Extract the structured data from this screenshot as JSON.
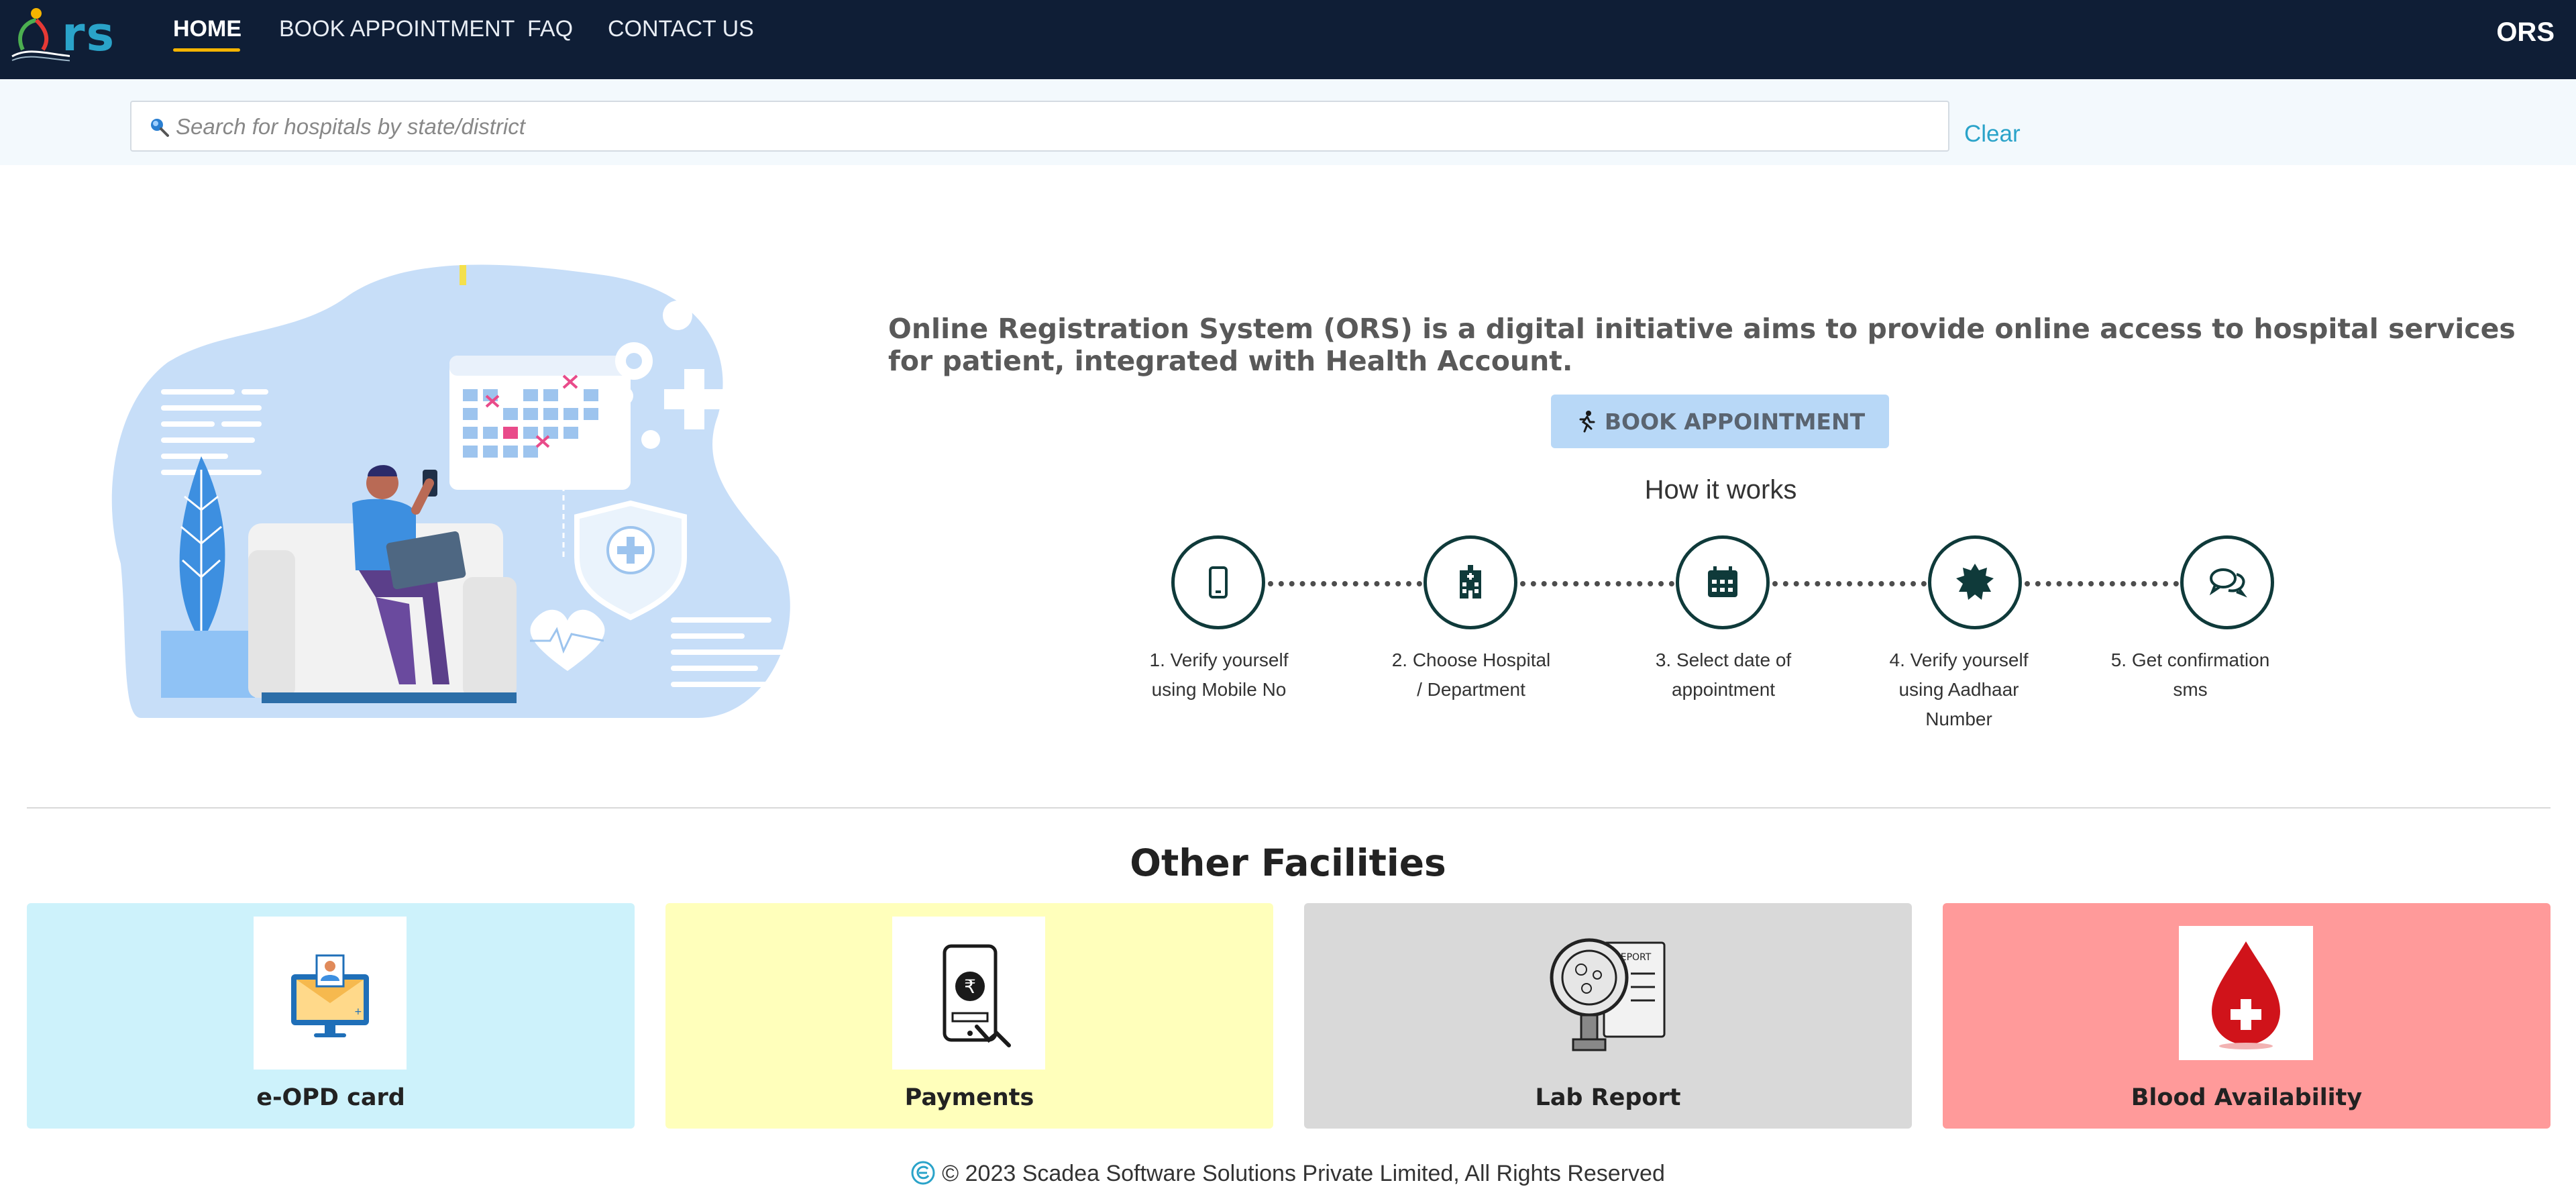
{
  "navbar": {
    "logo_text": "rs",
    "items": [
      {
        "label": "HOME"
      },
      {
        "label": "BOOK APPOINTMENT"
      },
      {
        "label": "FAQ"
      },
      {
        "label": "CONTACT US"
      }
    ],
    "right_label": "ORS"
  },
  "search": {
    "placeholder": "Search for hospitals by state/district",
    "value": "",
    "clear_label": "Clear"
  },
  "hero": {
    "description": "Online Registration System (ORS) is a digital initiative aims to provide online access to hospital services for patient, integrated with Health Account.",
    "book_button_label": "BOOK APPOINTMENT",
    "how_title": "How it works",
    "steps": [
      {
        "label": "1. Verify yourself using Mobile No",
        "icon": "mobile-icon"
      },
      {
        "label": "2. Choose Hospital / Department",
        "icon": "hospital-icon"
      },
      {
        "label": "3. Select date of appointment",
        "icon": "calendar-icon"
      },
      {
        "label": "4. Verify yourself using Aadhaar Number",
        "icon": "aadhaar-badge-icon"
      },
      {
        "label": "5. Get confirmation sms",
        "icon": "chat-icon"
      }
    ]
  },
  "facilities": {
    "title": "Other Facilities",
    "cards": [
      {
        "label": "e-OPD card",
        "color": "#cdf2fb",
        "icon": "eopd-card-icon"
      },
      {
        "label": "Payments",
        "color": "#ffffbb",
        "icon": "payments-icon"
      },
      {
        "label": "Lab Report",
        "color": "#d9d9d9",
        "icon": "lab-report-icon"
      },
      {
        "label": "Blood Availability",
        "color": "#ff9a9a",
        "icon": "blood-drop-icon"
      }
    ]
  },
  "footer": {
    "text": "© 2023 Scadea Software Solutions Private Limited, All Rights Reserved"
  },
  "colors": {
    "navbar_bg": "#0f1e36",
    "accent": "#2aa3c9",
    "nav_underline": "#f4b400",
    "step_ring": "#0f3a3a"
  }
}
